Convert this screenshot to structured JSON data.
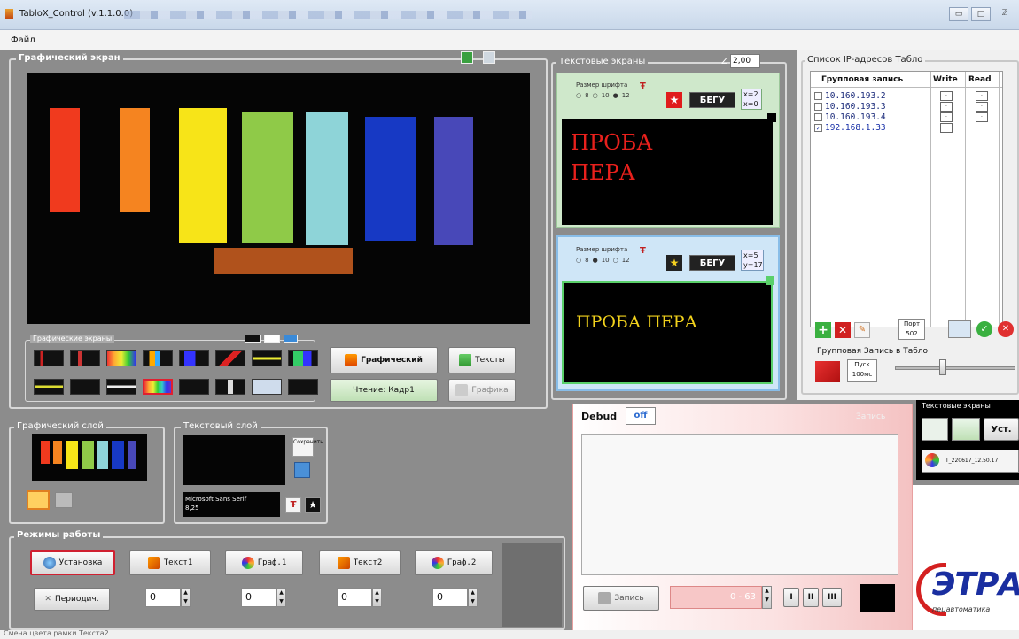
{
  "window": {
    "title": "TabloX_Control (v.1.1.0.0)",
    "min": "▭",
    "max": "□",
    "close": "ℤ"
  },
  "menu": {
    "file": "Файл"
  },
  "graphic_screen": {
    "title": "Графический экран",
    "bars": [
      {
        "color": "#f03a1e"
      },
      {
        "color": "#f58420"
      },
      {
        "color": "#f7e418"
      },
      {
        "color": "#8fca48"
      },
      {
        "color": "#8ed4d8"
      },
      {
        "color": "#1739c4"
      },
      {
        "color": "#4848b8"
      }
    ],
    "bar_extra_color": "#b0521c",
    "screens_title": "Графические экраны",
    "btn_graphic": "Графический",
    "btn_texts": "Тексты",
    "btn_read": "Чтение: Кадр1",
    "btn_graphics": "Графика"
  },
  "text_screens": {
    "title": "Текстовые экраны",
    "zoom_label": "Z",
    "zoom_value": "2,00",
    "panel1": {
      "font_label": "Размер шрифта",
      "sizes": [
        "8",
        "10",
        "12"
      ],
      "run_label": "БЕГУ",
      "xy": [
        "x=2",
        "x=0"
      ],
      "line1": "ПРОБА",
      "line2": "ПЕРА",
      "text_color": "#e8201c"
    },
    "panel2": {
      "font_label": "Размер шрифта",
      "sizes": [
        "8",
        "10",
        "12"
      ],
      "run_label": "БЕГУ",
      "xy": [
        "x=5",
        "y=17"
      ],
      "text": "ПРОБА ПЕРА",
      "text_color": "#f2d21c"
    }
  },
  "ip_list": {
    "title": "Список IP-адресов Табло",
    "col_group": "Групповая запись",
    "col_write": "Write",
    "col_read": "Read",
    "rows": [
      {
        "ip": "10.160.193.2",
        "checked": ""
      },
      {
        "ip": "10.160.193.3",
        "checked": ""
      },
      {
        "ip": "10.160.193.4",
        "checked": ""
      },
      {
        "ip": "192.168.1.33",
        "checked": "✓"
      }
    ],
    "port_label": "Порт",
    "port_value": "502",
    "group_write_label": "Групповая Запись в Табло",
    "start_label": "Пуск",
    "start_value": "100мс"
  },
  "graphic_layer": {
    "title": "Графический слой"
  },
  "text_layer": {
    "title": "Текстовый слой",
    "save_label": "Сохранить",
    "font_name": "Microsoft Sans Serif",
    "font_size": "8,25"
  },
  "modes": {
    "title": "Режимы работы",
    "install": "Установка",
    "text1": "Текст1",
    "graph1": "Граф.1",
    "text2": "Текст2",
    "graph2": "Граф.2",
    "periodic": "Периодич.",
    "values": [
      "0",
      "0",
      "0",
      "0"
    ]
  },
  "debug": {
    "title": "Debud",
    "toggle": "off",
    "record_header": "Запись",
    "record_btn": "Запись",
    "range": "0 - 63",
    "b1": "I",
    "b2": "II",
    "b3": "III"
  },
  "text_screens_mini": {
    "title": "Текстовые экраны",
    "set_label": "Уст.",
    "file": "T_220617_12.50.17"
  },
  "logo": {
    "main": "ЭТРА",
    "sub": "пецавтоматика"
  },
  "status": {
    "text": "Смена цвета рамки Текста2"
  }
}
